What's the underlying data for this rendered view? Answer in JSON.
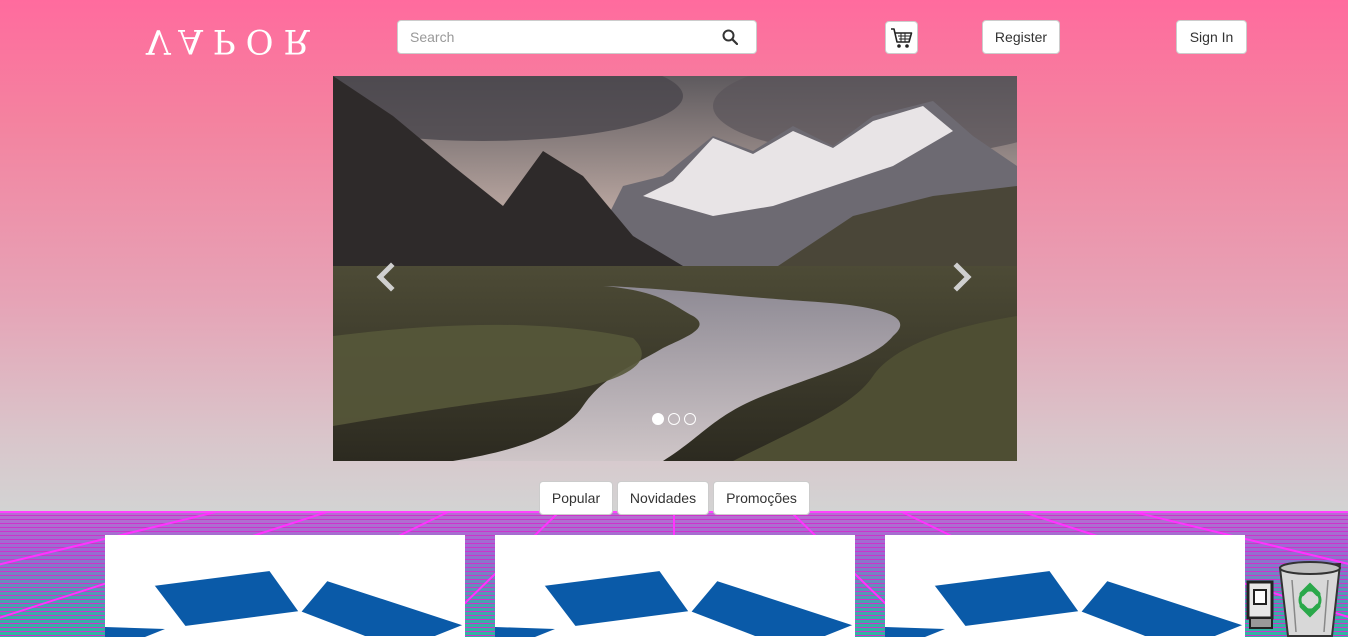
{
  "header": {
    "logo_text": "VAPOR",
    "search": {
      "placeholder": "Search",
      "value": ""
    },
    "register_label": "Register",
    "signin_label": "Sign In"
  },
  "carousel": {
    "slide_count": 3,
    "active_index": 0
  },
  "tabs": [
    {
      "label": "Popular"
    },
    {
      "label": "Novidades"
    },
    {
      "label": "Promoções"
    }
  ],
  "cards": [
    {
      "image": "open-box-illustration"
    },
    {
      "image": "open-box-illustration"
    },
    {
      "image": "open-box-illustration"
    }
  ],
  "icons": [
    "search-icon",
    "cart-icon",
    "chevron-left-icon",
    "chevron-right-icon",
    "recycle-bin-icon"
  ],
  "colors": {
    "sky_top": "#ff6b9e",
    "floor_grid": "#cc33cc",
    "box_blue": "#0a5aa8"
  }
}
